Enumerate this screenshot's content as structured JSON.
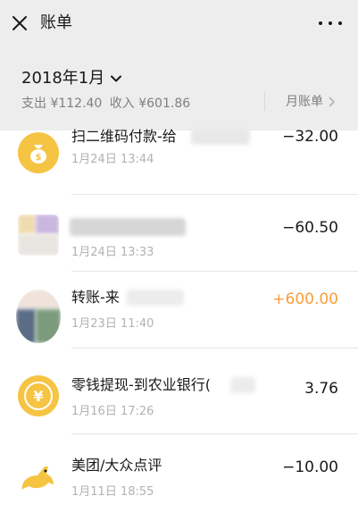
{
  "header": {
    "title": "账单"
  },
  "month": {
    "label": "2018年1月",
    "expense": "支出 ¥112.40",
    "income": "收入 ¥601.86",
    "monthly_link": "月账单"
  },
  "transactions": [
    {
      "name": "扫二维码付款-给",
      "time": "1月24日 13:44",
      "amount": "−32.00",
      "type": "expense",
      "icon": "money-bag-icon"
    },
    {
      "name": "",
      "time": "1月24日 13:33",
      "amount": "−60.50",
      "type": "expense",
      "icon": "avatar"
    },
    {
      "name": "转账-来",
      "time": "1月23日 11:40",
      "amount": "+600.00",
      "type": "income",
      "icon": "avatar"
    },
    {
      "name": "零钱提现-到农业银行(",
      "time": "1月16日 17:26",
      "amount": "3.76",
      "type": "neutral",
      "icon": "yuan-coin-icon"
    },
    {
      "name": "美团/大众点评",
      "time": "1月11日 18:55",
      "amount": "−10.00",
      "type": "expense",
      "icon": "meituan-kangaroo-icon"
    }
  ],
  "colors": {
    "accent_yellow": "#f6c443",
    "income_orange": "#fa9d3b",
    "background": "#ededed"
  }
}
